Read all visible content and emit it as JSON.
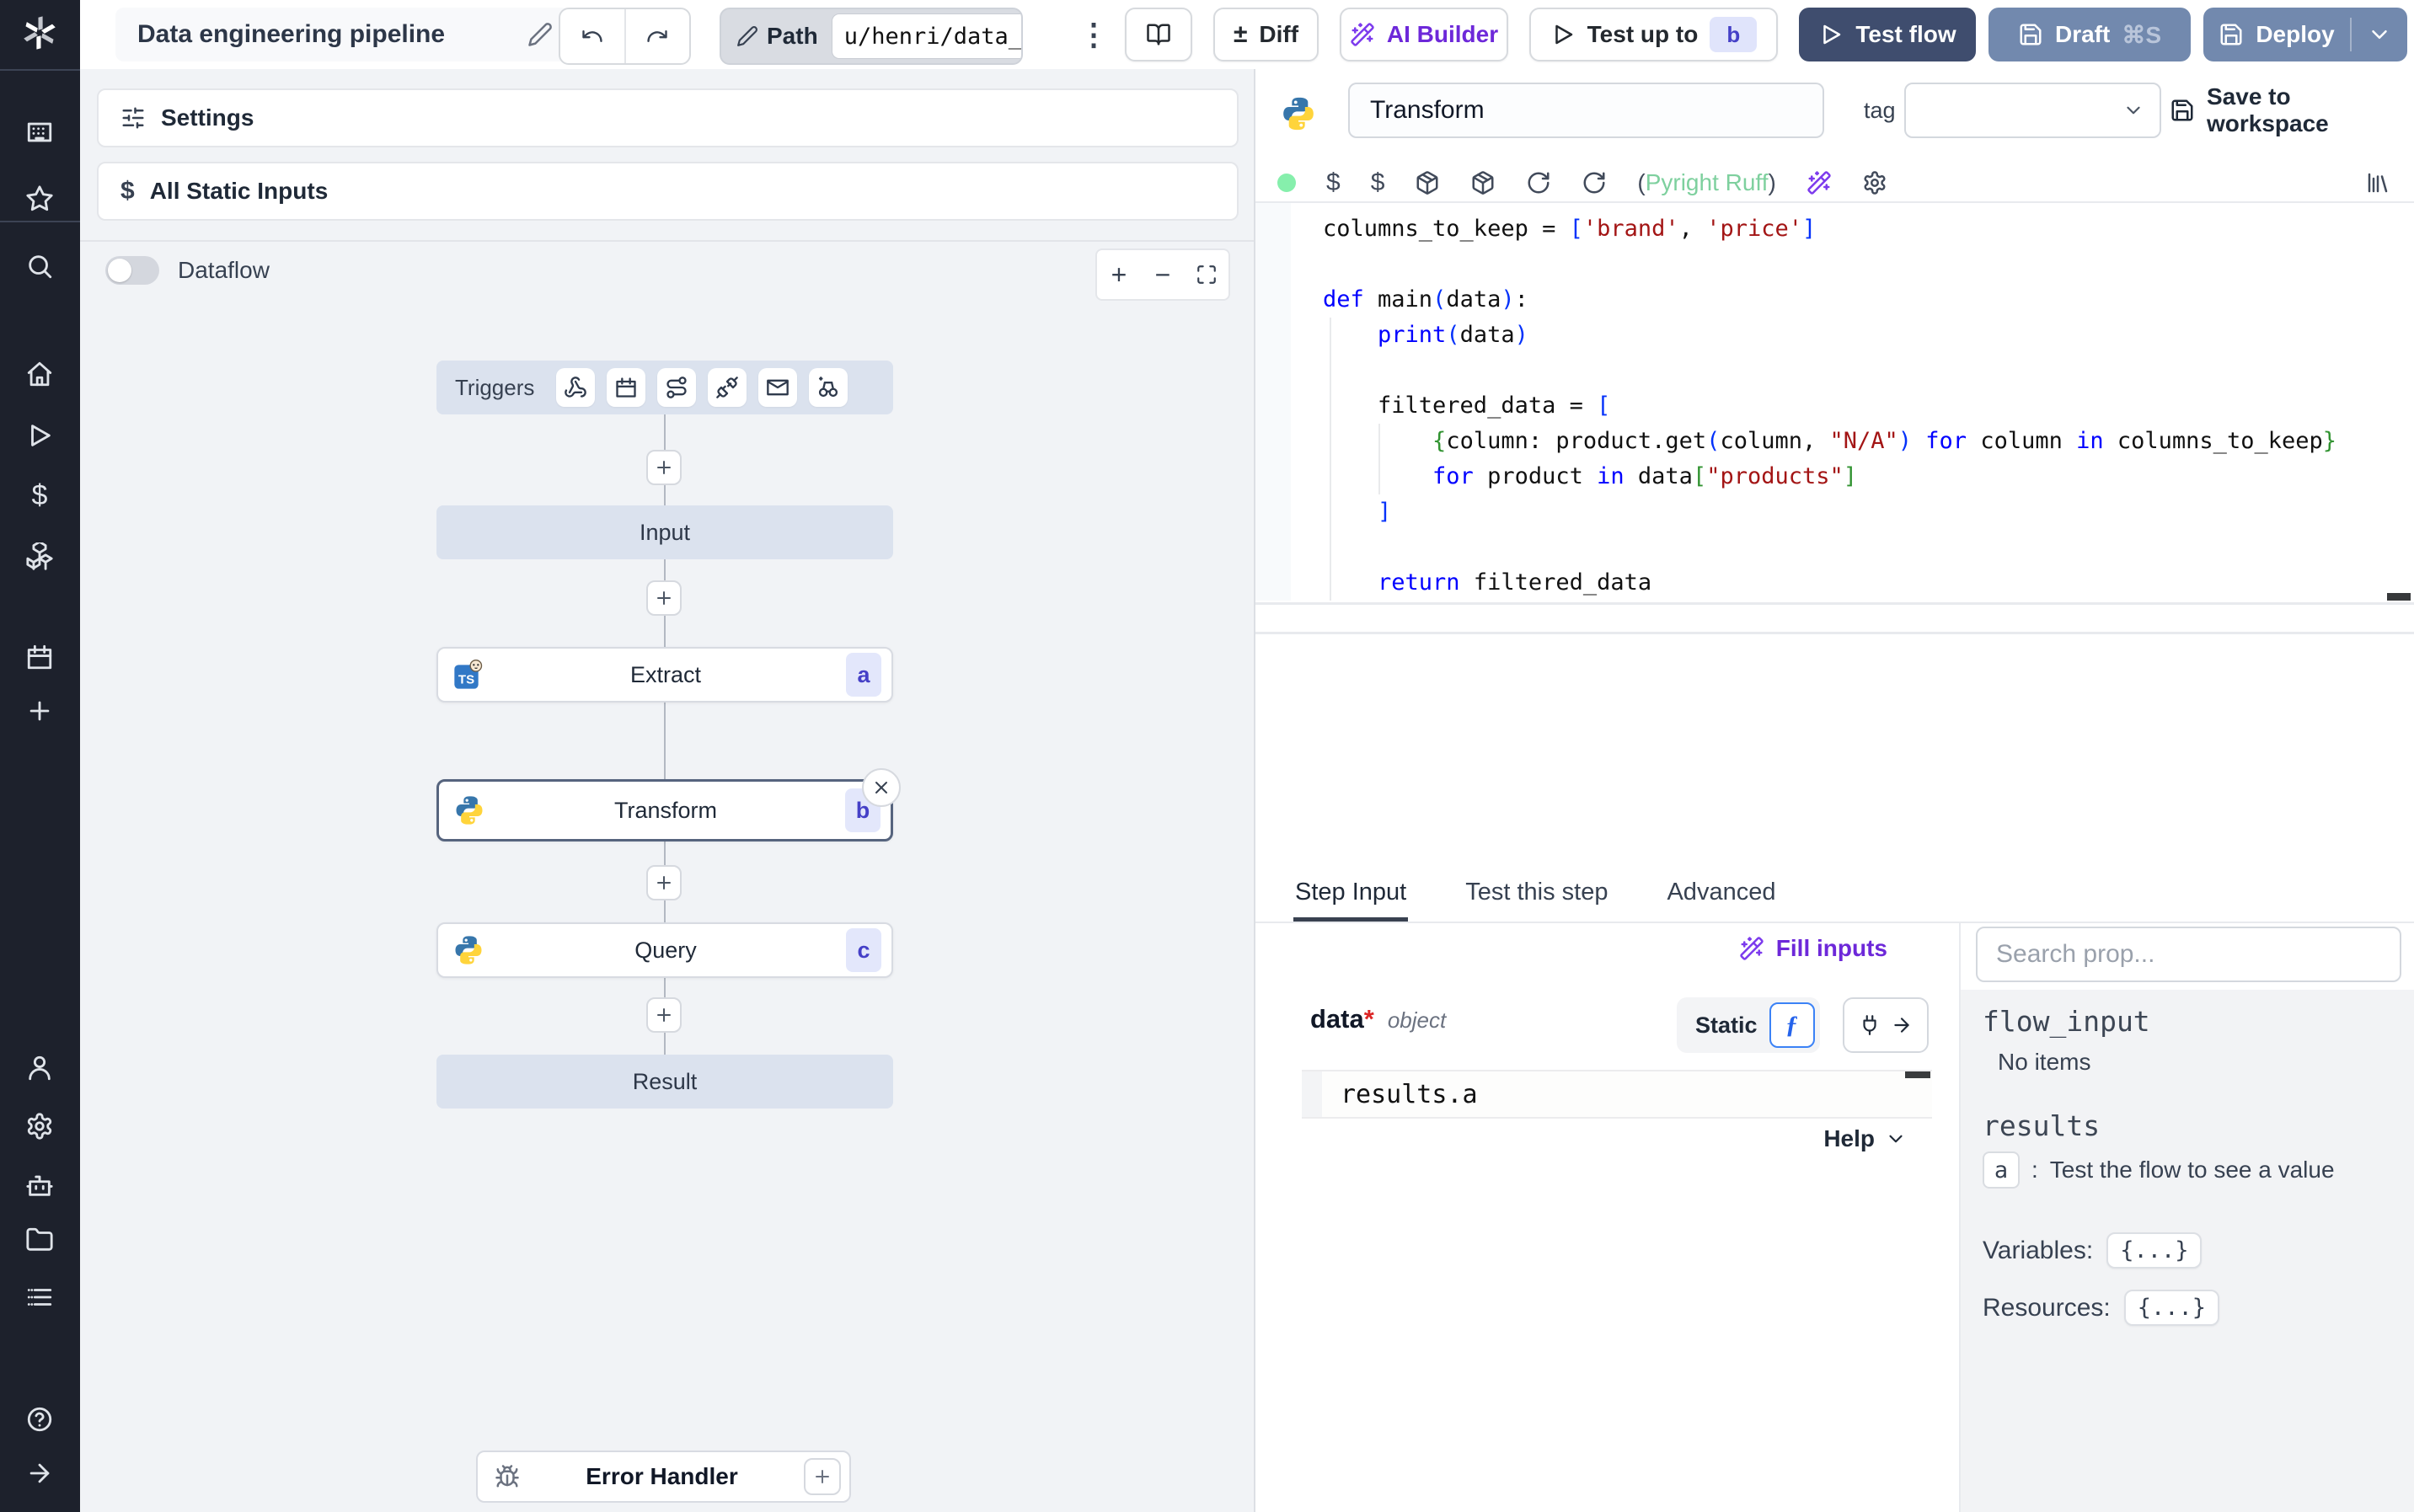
{
  "topbar": {
    "title": "Data engineering pipeline",
    "path_label": "Path",
    "path_value": "u/henri/data_",
    "diff_label": "Diff",
    "ai_builder_label": "AI Builder",
    "test_up_to_label": "Test up to",
    "test_up_to_badge": "b",
    "test_flow_label": "Test flow",
    "draft_label": "Draft",
    "draft_shortcut": "⌘S",
    "deploy_label": "Deploy"
  },
  "sidebar": {
    "icons": [
      "app-grid",
      "star",
      "search",
      "home",
      "play",
      "dollar",
      "cubes",
      "calendar",
      "plus-node",
      "person",
      "gear",
      "robot",
      "folder",
      "list",
      "help",
      "arrow-right"
    ]
  },
  "flow": {
    "settings_label": "Settings",
    "static_inputs_label": "All Static Inputs",
    "dataflow_label": "Dataflow",
    "triggers_label": "Triggers",
    "trigger_icons": [
      "webhook",
      "calendar",
      "route",
      "plug",
      "mail",
      "poll"
    ],
    "nodes": {
      "input": "Input",
      "extract": {
        "label": "Extract",
        "badge": "a"
      },
      "transform": {
        "label": "Transform",
        "badge": "b"
      },
      "query": {
        "label": "Query",
        "badge": "c"
      },
      "result": "Result"
    },
    "error_handler_label": "Error Handler"
  },
  "editor": {
    "step_name": "Transform",
    "tag_label": "tag",
    "save_label": "Save to workspace",
    "toolbar": {
      "icons_left": [
        "dollar",
        "dollar",
        "package",
        "package",
        "refresh",
        "refresh"
      ],
      "lint_open": "(",
      "lint_text": "Pyright Ruff",
      "lint_close": ")",
      "icons_right": [
        "wand",
        "gear"
      ],
      "library_icon": "library",
      "status_color": "#86efac"
    },
    "code_lines": [
      [
        {
          "t": "columns_to_keep = ",
          "c": "d"
        },
        {
          "t": "[",
          "c": "b1"
        },
        {
          "t": "'brand'",
          "c": "s"
        },
        {
          "t": ", ",
          "c": "d"
        },
        {
          "t": "'price'",
          "c": "s"
        },
        {
          "t": "]",
          "c": "b1"
        }
      ],
      [],
      [
        {
          "t": "def ",
          "c": "k"
        },
        {
          "t": "main",
          "c": "d"
        },
        {
          "t": "(",
          "c": "b1"
        },
        {
          "t": "data",
          "c": "d"
        },
        {
          "t": ")",
          "c": "b1"
        },
        {
          "t": ":",
          "c": "d"
        }
      ],
      [
        {
          "t": "    ",
          "c": "d"
        },
        {
          "t": "print",
          "c": "k"
        },
        {
          "t": "(",
          "c": "b1"
        },
        {
          "t": "data",
          "c": "d"
        },
        {
          "t": ")",
          "c": "b1"
        }
      ],
      [],
      [
        {
          "t": "    filtered_data = ",
          "c": "d"
        },
        {
          "t": "[",
          "c": "b1"
        }
      ],
      [
        {
          "t": "        ",
          "c": "d"
        },
        {
          "t": "{",
          "c": "b2"
        },
        {
          "t": "column: product.get",
          "c": "d"
        },
        {
          "t": "(",
          "c": "b1"
        },
        {
          "t": "column, ",
          "c": "d"
        },
        {
          "t": "\"N/A\"",
          "c": "s"
        },
        {
          "t": ")",
          "c": "b1"
        },
        {
          "t": " ",
          "c": "d"
        },
        {
          "t": "for",
          "c": "k"
        },
        {
          "t": " column ",
          "c": "d"
        },
        {
          "t": "in",
          "c": "k"
        },
        {
          "t": " columns_to_keep",
          "c": "d"
        },
        {
          "t": "}",
          "c": "b2"
        }
      ],
      [
        {
          "t": "        ",
          "c": "d"
        },
        {
          "t": "for",
          "c": "k"
        },
        {
          "t": " product ",
          "c": "d"
        },
        {
          "t": "in",
          "c": "k"
        },
        {
          "t": " data",
          "c": "d"
        },
        {
          "t": "[",
          "c": "b2"
        },
        {
          "t": "\"products\"",
          "c": "s"
        },
        {
          "t": "]",
          "c": "b2"
        }
      ],
      [
        {
          "t": "    ",
          "c": "d"
        },
        {
          "t": "]",
          "c": "b1"
        }
      ],
      [],
      [
        {
          "t": "    ",
          "c": "d"
        },
        {
          "t": "return",
          "c": "k"
        },
        {
          "t": " filtered_data",
          "c": "d"
        }
      ]
    ]
  },
  "tabs": {
    "items": [
      "Step Input",
      "Test this step",
      "Advanced"
    ],
    "active_index": 0
  },
  "step_input": {
    "fill_inputs_label": "Fill inputs",
    "field_name": "data",
    "required_mark": "*",
    "field_type": "object",
    "static_label": "Static",
    "expression": "results.a",
    "help_label": "Help"
  },
  "props_panel": {
    "search_placeholder": "Search prop...",
    "flow_input_label": "flow_input",
    "flow_input_empty": "No items",
    "results_label": "results",
    "result_key": "a",
    "result_sep": ":",
    "result_hint": "Test the flow to see a value",
    "variables_label": "Variables:",
    "variables_value": "{...}",
    "resources_label": "Resources:",
    "resources_value": "{...}"
  },
  "icons": {
    "logo": "windmill",
    "pencil": "pencil",
    "undo": "undo",
    "redo": "redo",
    "kebab": "kebab",
    "book": "book",
    "diff": "diff",
    "wand": "wand",
    "play": "play",
    "save": "save",
    "chevron_down": "chev-down",
    "sliders": "sliders",
    "dollar": "dollar",
    "close": "close",
    "bug": "bug",
    "plus": "plus-node",
    "zoom_in": "zoom-in",
    "zoom_out": "zoom-out",
    "fullscreen": "fullscreen",
    "python": "python",
    "bun_ts": "bun-ts",
    "function": "function",
    "plug_input": "plug2",
    "arrow_right": "arrow-sm",
    "library": "library"
  },
  "colors": {
    "accent_dark": "#3f4d6e",
    "accent_slate": "#7289ae",
    "purple": "#7c3aed",
    "badge_bg": "#e3e7fb",
    "badge_text": "#4540c7",
    "node_ghost_bg": "#dbe2ee",
    "canvas_bg": "#f1f3f6",
    "status_green": "#86efac"
  }
}
